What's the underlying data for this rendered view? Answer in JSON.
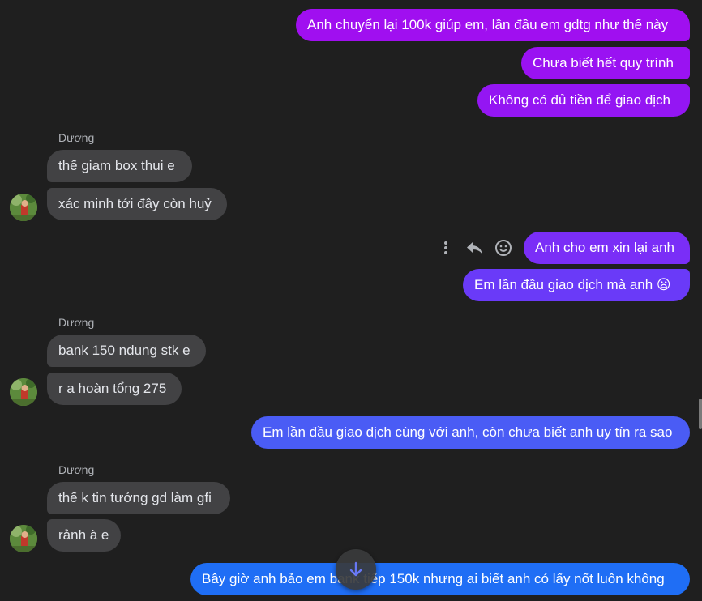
{
  "conversation": {
    "outgoing_1": [
      "Anh chuyển lại 100k giúp em, lần đầu em gdtg như thế này",
      "Chưa biết hết quy trình",
      "Không có đủ tiền để giao dịch"
    ],
    "group_1": {
      "sender": "Dương",
      "messages": [
        "thế giam box thui e",
        "xác minh tới đây còn huỷ"
      ]
    },
    "outgoing_2": [
      "Anh cho em xin lại anh",
      "Em lần đầu giao dịch mà anh 😦"
    ],
    "group_2": {
      "sender": "Dương",
      "messages": [
        "bank 150 ndung stk e",
        "r a hoàn tổng 275"
      ]
    },
    "outgoing_3": [
      "Em lần đầu giao dịch cùng với anh, còn chưa biết anh uy tín ra sao"
    ],
    "group_3": {
      "sender": "Dương",
      "messages": [
        "thế k tin tưởng gd làm gfi",
        "rảnh à e"
      ]
    },
    "outgoing_4": [
      "Bây giờ anh bảo em bank tiếp 150k nhưng ai biết anh có lấy nốt luôn không"
    ]
  },
  "message_actions": [
    "more-options-icon",
    "reply-icon",
    "react-emoji-icon"
  ],
  "scroll_to_bottom_icon": "arrow-down-icon",
  "colors": {
    "background": "#1f1f1f",
    "incoming_bubble": "#424244",
    "outgoing_purple": "#9b0ff4",
    "outgoing_violet": "#6d35f8",
    "outgoing_indigo": "#4a5cf5",
    "outgoing_blue": "#1f6ef5"
  }
}
